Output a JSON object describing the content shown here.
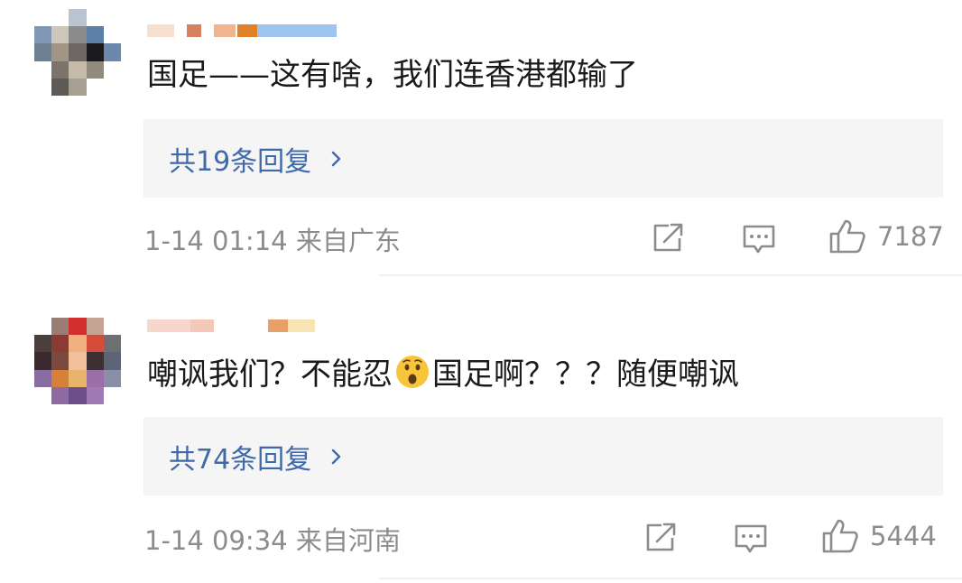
{
  "comments": [
    {
      "text": "国足——这有啥，我们连香港都输了",
      "replies_label": "共19条回复",
      "meta": "1-14 01:14 来自广东",
      "likes": "7187",
      "avatar_colors": [
        "#ffffff",
        "#ffffff",
        "#b9c4cf",
        "#ffffff",
        "#ffffff",
        "#7e98b6",
        "#cfc6ba",
        "#8b8b8b",
        "#5c7fa8",
        "#ffffff",
        "#6f7f92",
        "#a19685",
        "#6f6862",
        "#1b1b1d",
        "#6d88ae",
        "#ffffff",
        "#7c746b",
        "#c6baa8",
        "#938a7e",
        "#ffffff",
        "#ffffff",
        "#5e5a56",
        "#a89f93",
        "#ffffff",
        "#ffffff"
      ],
      "username_colors": [
        "#f7dfcf",
        "#d7825f",
        "#f0b48e",
        "#e08028",
        "#9fc4ee"
      ]
    },
    {
      "text_before": "嘲讽我们？不能忍",
      "text_after": "国足啊？？？随便嘲讽",
      "replies_label": "共74条回复",
      "meta": "1-14 09:34 来自河南",
      "likes": "5444",
      "avatar_colors": [
        "#ffffff",
        "#9a7e74",
        "#d32f2f",
        "#c5a494",
        "#ffffff",
        "#4b3f3c",
        "#8b3a34",
        "#f0b080",
        "#d64c3a",
        "#6d6f73",
        "#3a2a2e",
        "#7a4a3f",
        "#f2c09a",
        "#3b2f31",
        "#5e6478",
        "#8a6ca0",
        "#d6803a",
        "#e8b36a",
        "#9a6ea6",
        "#8a8fa8",
        "#ffffff",
        "#8e6aa0",
        "#6c4f8a",
        "#a07ab5",
        "#ffffff"
      ],
      "username_colors": [
        "#f6d6cd",
        "#f3c8b6",
        "#e7a06a",
        "#f8e3b3"
      ]
    }
  ]
}
